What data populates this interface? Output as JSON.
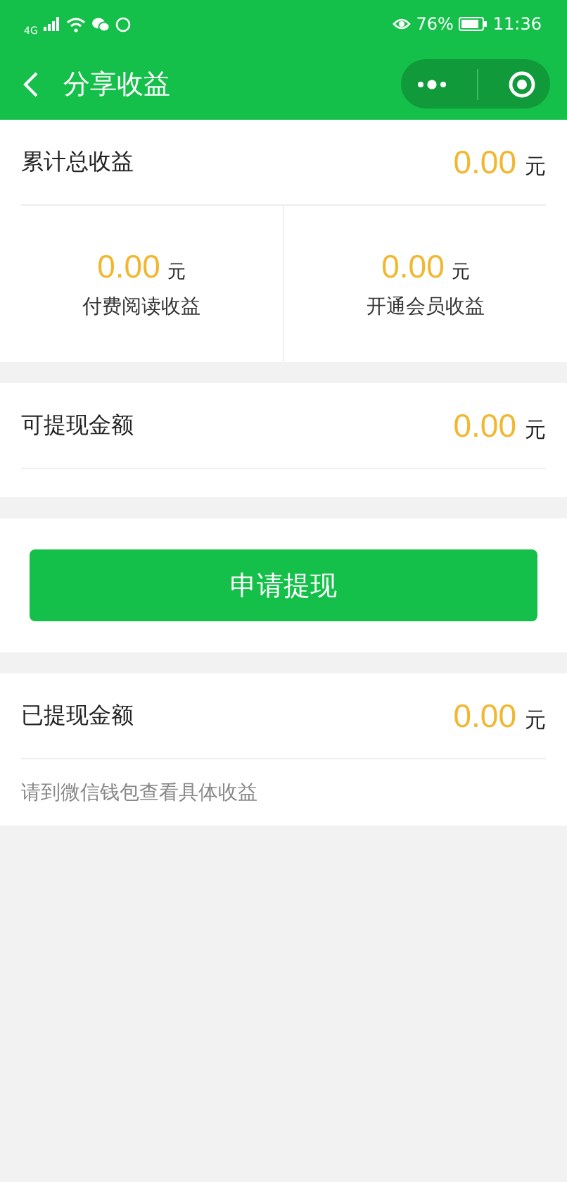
{
  "status_bar": {
    "network": "4G",
    "battery": "76%",
    "time": "11:36"
  },
  "header": {
    "title": "分享收益"
  },
  "total": {
    "label": "累计总收益",
    "amount": "0.00",
    "unit": "元"
  },
  "breakdown": [
    {
      "amount": "0.00",
      "unit": "元",
      "label": "付费阅读收益"
    },
    {
      "amount": "0.00",
      "unit": "元",
      "label": "开通会员收益"
    }
  ],
  "withdrawable": {
    "label": "可提现金额",
    "amount": "0.00",
    "unit": "元"
  },
  "withdraw_button": "申请提现",
  "withdrawn": {
    "label": "已提现金额",
    "amount": "0.00",
    "unit": "元"
  },
  "note": "请到微信钱包查看具体收益"
}
